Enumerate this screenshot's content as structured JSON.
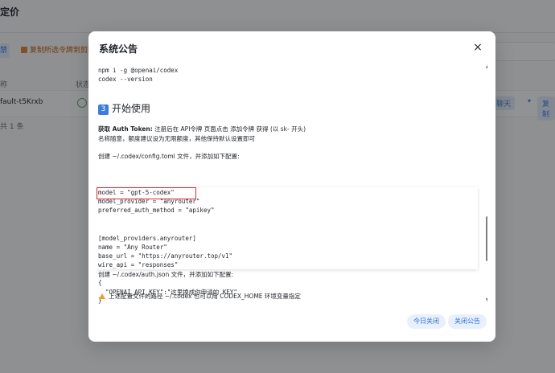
{
  "background": {
    "title": "定价",
    "left_button": "禁",
    "copy_button": "复制所选令牌到剪贴板",
    "col_name": "称",
    "col_status": "状态",
    "row_name": "fault-t5Krxb",
    "row_btn1": "聊天",
    "row_caret": "▾",
    "row_btn2": "复制",
    "total": "共 1 条"
  },
  "modal": {
    "title": "系统公告",
    "close_icon": "×",
    "code_install": [
      "npm i -g @openai/codex",
      "codex --version"
    ],
    "section_num": "3",
    "section_title": "开始使用",
    "auth_label": "获取 Auth Token:",
    "auth_text": " 注册后在 API令牌 页面点击 添加令牌 获得 (以 sk- 开头)",
    "auth_note": "名称随意，额度建议设为无限额度，其他保持默认设置即可",
    "config_intro": "创建 ~/.codex/config.toml 文件，并添加如下配置:",
    "config_lines": [
      "model = \"gpt-5-codex\"",
      "model_provider = \"anyrouter\"",
      "preferred_auth_method = \"apikey\"",
      "",
      "",
      "[model_providers.anyrouter]",
      "name = \"Any Router\"",
      "base_url = \"https://anyrouter.top/v1\"",
      "wire_api = \"responses\""
    ],
    "auth_intro": "创建 ~/.codex/auth.json 文件，并添加如下配置:",
    "auth_lines": [
      "{",
      "  \"OPENAI_API_KEY\":\"这里换成你申请的 KEY\"",
      "}"
    ],
    "warning": "上述配置文件的路径 ~/.codex 也可以用 CODEX_HOME 环境变量指定",
    "btn_today": "今日关闭",
    "btn_close": "关闭公告"
  },
  "icons": {
    "close": "close-icon",
    "warning": "warning-icon",
    "scroll_up": "▲",
    "scroll_down": "▼"
  }
}
